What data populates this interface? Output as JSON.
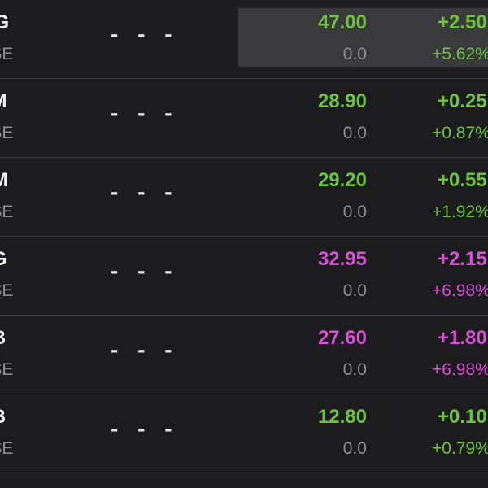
{
  "colors": {
    "up": "#6bc33e",
    "ceiling": "#d94fd6",
    "muted": "#8e8e93",
    "background": "#1c1c1e"
  },
  "rows": [
    {
      "symbol": "MG",
      "exchange": "OSE",
      "spark": "- - -",
      "price": "47.00",
      "volume": "0.0",
      "change": "+2.50",
      "pct": "+5.62%",
      "trend": "up",
      "selected": true
    },
    {
      "symbol": "PM",
      "exchange": "OSE",
      "spark": "- - -",
      "price": "28.90",
      "volume": "0.0",
      "change": "+0.25",
      "pct": "+0.87%",
      "trend": "up",
      "selected": false
    },
    {
      "symbol": "CM",
      "exchange": "OSE",
      "spark": "- - -",
      "price": "29.20",
      "volume": "0.0",
      "change": "+0.55",
      "pct": "+1.92%",
      "trend": "up",
      "selected": false
    },
    {
      "symbol": "DG",
      "exchange": "OSE",
      "spark": "- - -",
      "price": "32.95",
      "volume": "0.0",
      "change": "+2.15",
      "pct": "+6.98%",
      "trend": "ceiling",
      "selected": false
    },
    {
      "symbol": "BB",
      "exchange": "OSE",
      "spark": "- - -",
      "price": "27.60",
      "volume": "0.0",
      "change": "+1.80",
      "pct": "+6.98%",
      "trend": "ceiling",
      "selected": false
    },
    {
      "symbol": "CB",
      "exchange": "OSE",
      "spark": "- - -",
      "price": "12.80",
      "volume": "0.0",
      "change": "+0.10",
      "pct": "+0.79%",
      "trend": "up",
      "selected": false
    }
  ]
}
